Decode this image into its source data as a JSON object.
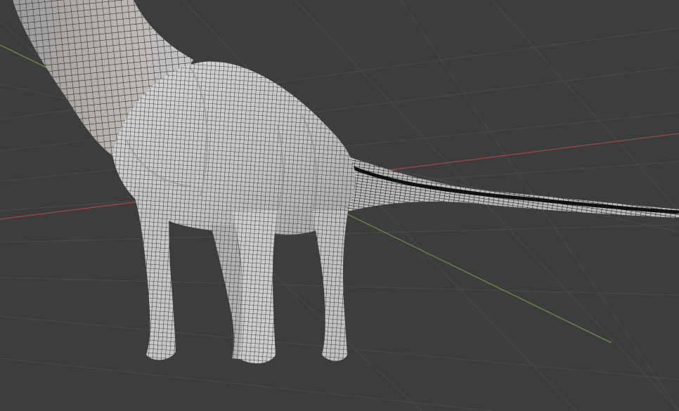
{
  "viewport": {
    "mode": "3d-viewport",
    "shading": "solid-wireframe-overlay",
    "show_grid_floor": true,
    "show_x_axis": true,
    "show_y_axis": true,
    "colors": {
      "background": "#3d3d3d",
      "grid_line": "#4b4b4b",
      "x_axis": "#9a4a4a",
      "y_axis": "#6f8a45",
      "mesh_fill": "#c8c8c8",
      "mesh_shadow": "#9e9e9e",
      "wire": "#1a1a1a"
    }
  },
  "object": {
    "kind": "sauropod-dinosaur-mesh",
    "parts": [
      "neck",
      "torso",
      "front-left-leg",
      "front-right-leg",
      "hind-left-leg",
      "hind-right-leg",
      "tail"
    ]
  }
}
